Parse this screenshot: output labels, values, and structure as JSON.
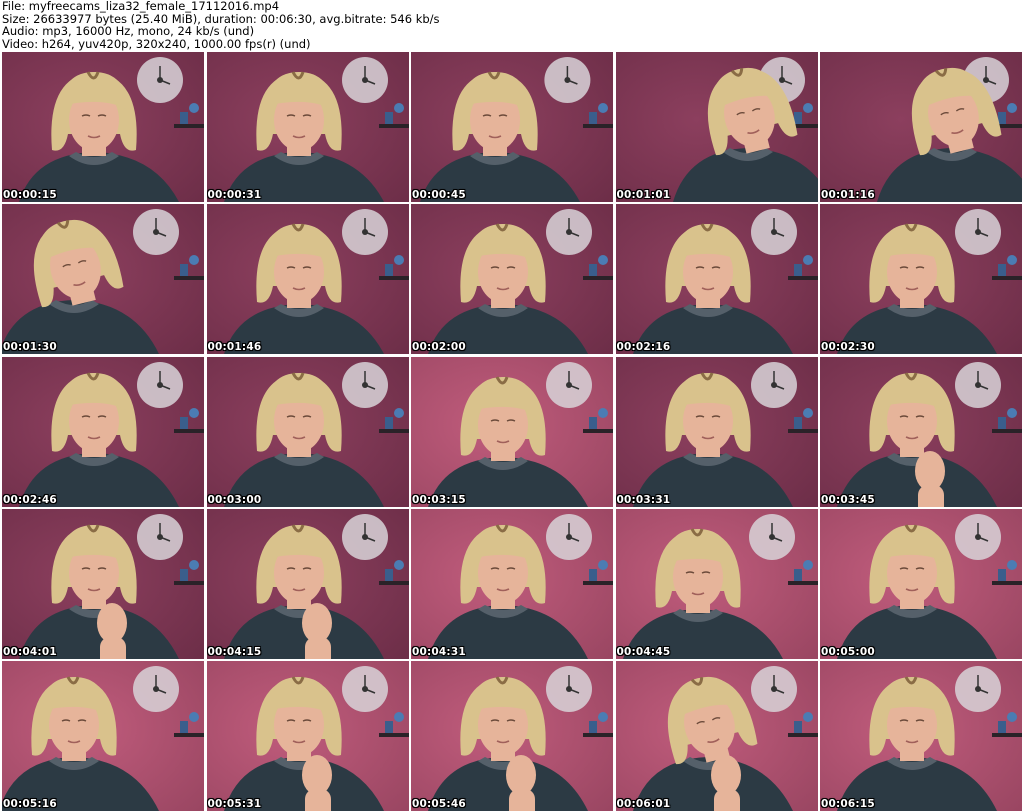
{
  "header": {
    "file": "File: myfreecams_liza32_female_17112016.mp4",
    "size": "Size: 26633977 bytes (25.40 MiB), duration: 00:06:30, avg.bitrate: 546 kb/s",
    "audio": "Audio: mp3, 16000 Hz, mono, 24 kb/s (und)",
    "video": "Video: h264, yuv420p, 320x240, 1000.00 fps(r) (und)"
  },
  "frames": [
    {
      "timestamp": "00:00:15",
      "lighting": "purple",
      "pose": "down",
      "hand": false,
      "shift": 0
    },
    {
      "timestamp": "00:00:31",
      "lighting": "purple",
      "pose": "down",
      "hand": false,
      "shift": 0
    },
    {
      "timestamp": "00:00:45",
      "lighting": "purple",
      "pose": "down",
      "hand": false,
      "shift": -8
    },
    {
      "timestamp": "00:01:01",
      "lighting": "purple",
      "pose": "tilt",
      "hand": false,
      "shift": 40
    },
    {
      "timestamp": "00:01:16",
      "lighting": "purple",
      "pose": "tilt",
      "hand": false,
      "shift": 40
    },
    {
      "timestamp": "00:01:30",
      "lighting": "purple",
      "pose": "tilt",
      "hand": false,
      "shift": -20
    },
    {
      "timestamp": "00:01:46",
      "lighting": "purple",
      "pose": "down",
      "hand": false,
      "shift": 0
    },
    {
      "timestamp": "00:02:00",
      "lighting": "purple",
      "pose": "down",
      "hand": false,
      "shift": 0
    },
    {
      "timestamp": "00:02:16",
      "lighting": "purple",
      "pose": "down",
      "hand": false,
      "shift": 0
    },
    {
      "timestamp": "00:02:30",
      "lighting": "purple",
      "pose": "down",
      "hand": false,
      "shift": 0
    },
    {
      "timestamp": "00:02:46",
      "lighting": "purple",
      "pose": "front",
      "hand": false,
      "shift": 0
    },
    {
      "timestamp": "00:03:00",
      "lighting": "purple",
      "pose": "front",
      "hand": false,
      "shift": 0
    },
    {
      "timestamp": "00:03:15",
      "lighting": "pink",
      "pose": "down",
      "hand": false,
      "shift": 0
    },
    {
      "timestamp": "00:03:31",
      "lighting": "purple",
      "pose": "front",
      "hand": false,
      "shift": 0
    },
    {
      "timestamp": "00:03:45",
      "lighting": "purple",
      "pose": "front",
      "hand": true,
      "shift": 0
    },
    {
      "timestamp": "00:04:01",
      "lighting": "purple",
      "pose": "front",
      "hand": true,
      "shift": 0
    },
    {
      "timestamp": "00:04:15",
      "lighting": "purple",
      "pose": "front",
      "hand": true,
      "shift": 0
    },
    {
      "timestamp": "00:04:31",
      "lighting": "pink",
      "pose": "front",
      "hand": false,
      "shift": 0
    },
    {
      "timestamp": "00:04:45",
      "lighting": "pink",
      "pose": "down",
      "hand": false,
      "shift": -10
    },
    {
      "timestamp": "00:05:00",
      "lighting": "pink",
      "pose": "front",
      "hand": false,
      "shift": 0
    },
    {
      "timestamp": "00:05:16",
      "lighting": "pink",
      "pose": "front",
      "hand": false,
      "shift": -20
    },
    {
      "timestamp": "00:05:31",
      "lighting": "pink",
      "pose": "front",
      "hand": true,
      "shift": 0
    },
    {
      "timestamp": "00:05:46",
      "lighting": "pink",
      "pose": "front",
      "hand": true,
      "shift": 0
    },
    {
      "timestamp": "00:06:01",
      "lighting": "pink",
      "pose": "tilt",
      "hand": true,
      "shift": 0
    },
    {
      "timestamp": "00:06:15",
      "lighting": "pink",
      "pose": "front",
      "hand": false,
      "shift": 0
    }
  ],
  "colors": {
    "purple_wall": "#8c3f5e",
    "pink_wall": "#c05c7c",
    "hair": "#d9c28c",
    "hair_dark": "#8a6c45",
    "skin": "#e6b49a",
    "shirt": "#2c3a44",
    "clock": "#d8d4d8",
    "timestamp_text": "#ffffff"
  }
}
